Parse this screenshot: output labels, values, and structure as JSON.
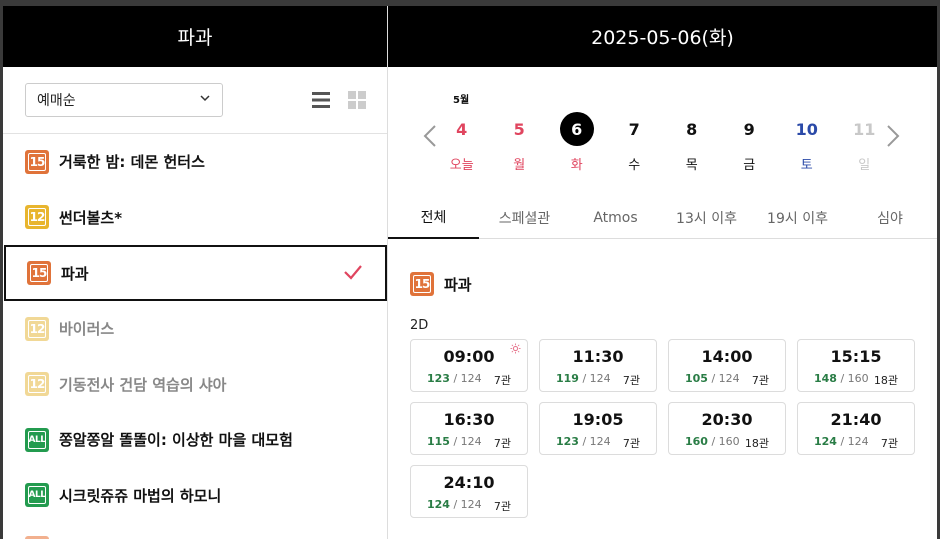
{
  "left": {
    "header_title": "파과",
    "sort": {
      "selected": "예매순"
    },
    "movies": [
      {
        "title": "거룩한 밤: 데몬 헌터스",
        "rating": "15",
        "dim": false,
        "selected": false
      },
      {
        "title": "썬더볼츠*",
        "rating": "12",
        "dim": false,
        "selected": false
      },
      {
        "title": "파과",
        "rating": "15",
        "dim": false,
        "selected": true
      },
      {
        "title": "바이러스",
        "rating": "12",
        "dim": true,
        "selected": false
      },
      {
        "title": "기동전사 건담 역습의 샤아",
        "rating": "12",
        "dim": true,
        "selected": false
      },
      {
        "title": "쫑알쫑알 똘똘이: 이상한 마을 대모험",
        "rating": "ALL",
        "dim": false,
        "selected": false
      },
      {
        "title": "시크릿쥬쥬 마법의 하모니",
        "rating": "ALL",
        "dim": false,
        "selected": false
      }
    ]
  },
  "right": {
    "header_date": "2025-05-06(화)",
    "month_label": "5월",
    "days": [
      {
        "num": "4",
        "weekday": "오늘",
        "color": "red",
        "selected": false
      },
      {
        "num": "5",
        "weekday": "월",
        "color": "red",
        "selected": false
      },
      {
        "num": "6",
        "weekday": "화",
        "color": "red",
        "selected": true
      },
      {
        "num": "7",
        "weekday": "수",
        "color": "black",
        "selected": false
      },
      {
        "num": "8",
        "weekday": "목",
        "color": "black",
        "selected": false
      },
      {
        "num": "9",
        "weekday": "금",
        "color": "black",
        "selected": false
      },
      {
        "num": "10",
        "weekday": "토",
        "color": "blue",
        "selected": false
      },
      {
        "num": "11",
        "weekday": "일",
        "color": "gray",
        "selected": false
      }
    ],
    "tabs": [
      "전체",
      "스페셜관",
      "Atmos",
      "13시 이후",
      "19시 이후",
      "심야"
    ],
    "active_tab": 0,
    "movie_title": "파과",
    "movie_rating": "15",
    "format": "2D",
    "showtimes": [
      {
        "time": "09:00",
        "remaining": "123",
        "total": "/ 124",
        "hall": "7관",
        "morning": true
      },
      {
        "time": "11:30",
        "remaining": "119",
        "total": "/ 124",
        "hall": "7관",
        "morning": false
      },
      {
        "time": "14:00",
        "remaining": "105",
        "total": "/ 124",
        "hall": "7관",
        "morning": false
      },
      {
        "time": "15:15",
        "remaining": "148",
        "total": "/ 160",
        "hall": "18관",
        "morning": false
      },
      {
        "time": "16:30",
        "remaining": "115",
        "total": "/ 124",
        "hall": "7관",
        "morning": false
      },
      {
        "time": "19:05",
        "remaining": "123",
        "total": "/ 124",
        "hall": "7관",
        "morning": false
      },
      {
        "time": "20:30",
        "remaining": "160",
        "total": "/ 160",
        "hall": "18관",
        "morning": false
      },
      {
        "time": "21:40",
        "remaining": "124",
        "total": "/ 124",
        "hall": "7관",
        "morning": false
      },
      {
        "time": "24:10",
        "remaining": "124",
        "total": "/ 124",
        "hall": "7관",
        "morning": false
      }
    ]
  },
  "colors": {
    "weekend_red": "#e0455f",
    "saturday_blue": "#2b4aa8",
    "seats_green": "#2a7d46",
    "check_red": "#e0455f"
  }
}
